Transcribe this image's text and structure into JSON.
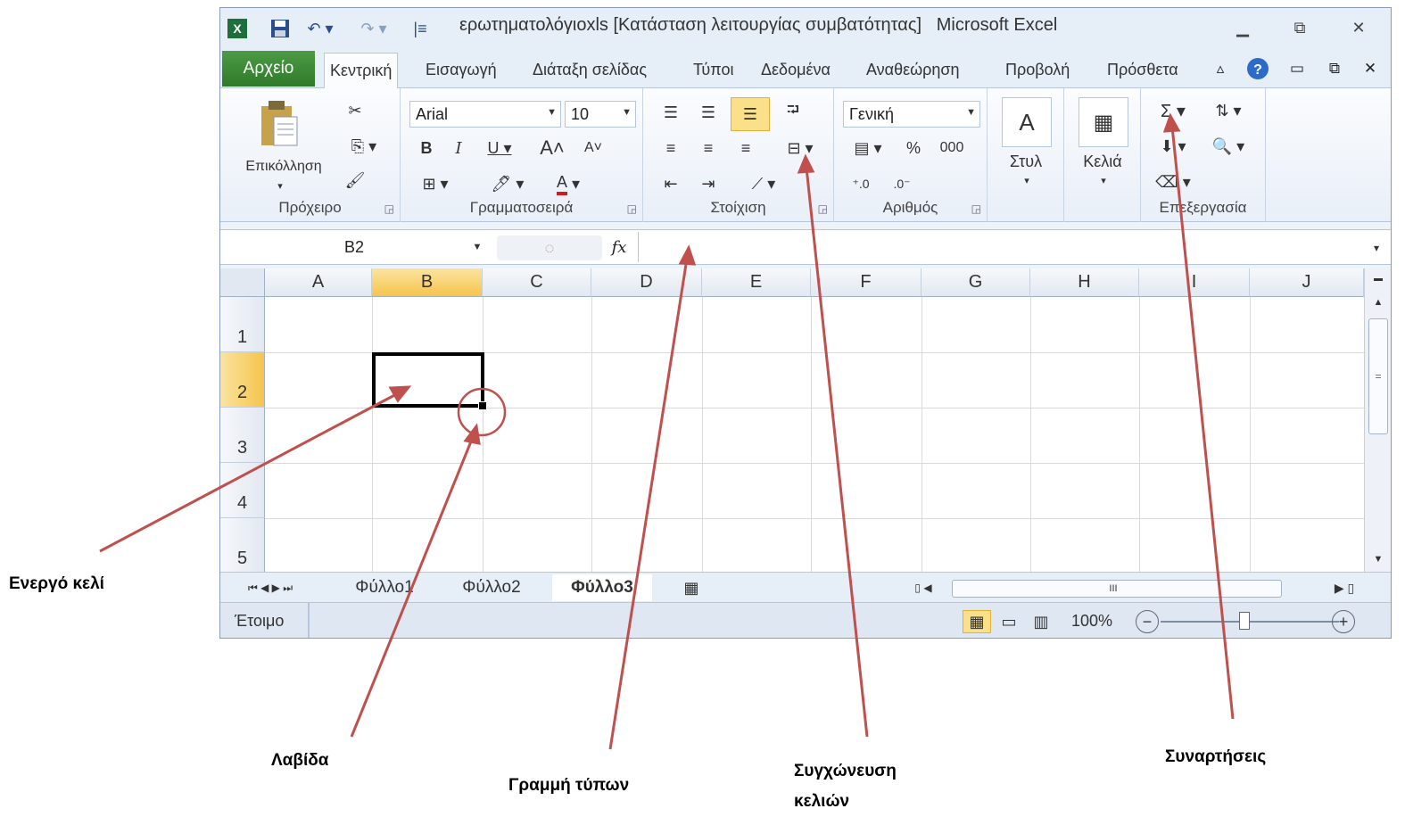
{
  "window": {
    "title": "ερωτηματολόγιοxls [Κατάσταση λειτουργίας συμβατότητας]",
    "app_name": "Microsoft Excel",
    "minimize_label": "▭",
    "maximize_label": "⧉",
    "close_label": "✕"
  },
  "tabs": {
    "file": "Αρχείο",
    "items": [
      "Κεντρική",
      "Εισαγωγή",
      "Διάταξη σελίδας",
      "Τύποι",
      "Δεδομένα",
      "Αναθεώρηση",
      "Προβολή",
      "Πρόσθετα"
    ]
  },
  "ribbon": {
    "clipboard": {
      "label": "Πρόχειρο",
      "paste": "Επικόλληση"
    },
    "font": {
      "label": "Γραμματοσειρά",
      "font_name": "Arial",
      "font_size": "10"
    },
    "alignment": {
      "label": "Στοίχιση"
    },
    "number": {
      "label": "Αριθμός",
      "format": "Γενική",
      "percent": "%",
      "thousands": "000"
    },
    "styles": {
      "label": "Στυλ"
    },
    "cells": {
      "label": "Κελιά"
    },
    "editing": {
      "label": "Επεξεργασία"
    }
  },
  "formula_bar": {
    "name_box": "B2",
    "fx": "fx",
    "value": ""
  },
  "grid": {
    "columns": [
      "A",
      "B",
      "C",
      "D",
      "E",
      "F",
      "G",
      "H",
      "I",
      "J"
    ],
    "rows": [
      "1",
      "2",
      "3",
      "4",
      "5"
    ],
    "selected_column": "B",
    "selected_row": "2"
  },
  "sheets": {
    "tabs": [
      "Φύλλο1",
      "Φύλλο2",
      "Φύλλο3"
    ],
    "active": "Φύλλο3"
  },
  "status": {
    "text": "Έτοιμο",
    "zoom": "100%"
  },
  "annotations": {
    "active_cell": "Ενεργό κελί",
    "fill_handle": "Λαβίδα",
    "formula_bar": "Γραμμή τύπων",
    "merge_cells_line1": "Συγχώνευση",
    "merge_cells_line2": "κελιών",
    "functions": "Συναρτήσεις"
  },
  "colors": {
    "file_tab": "#3a8a34",
    "selected_header": "#f5c54c",
    "annotation_arrow": "#c0504d"
  }
}
